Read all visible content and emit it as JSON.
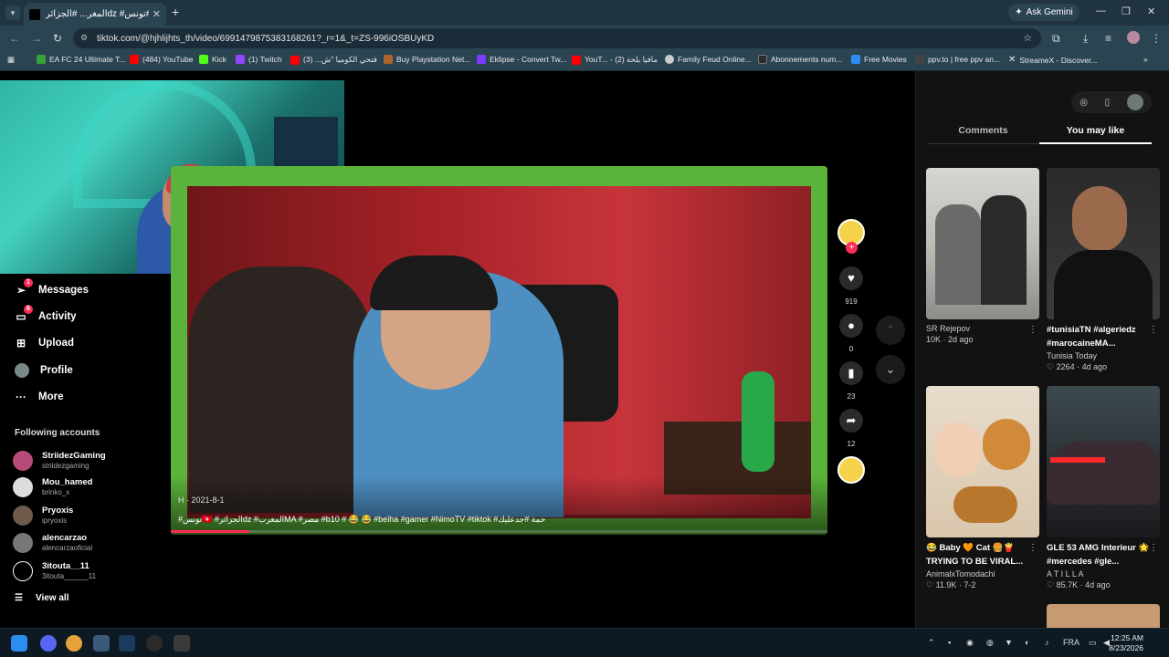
{
  "browser": {
    "tab_title": "المغر... #الجزائرdz #تونس#",
    "ask_gemini": "Ask Gemini",
    "url": "tiktok.com/@hjhlijhts_th/video/6991479875383168261?_r=1&_t=ZS-996iOSBUyKD",
    "bookmarks": [
      {
        "label": "EA FC 24 Ultimate T...",
        "color": "#35a33a"
      },
      {
        "label": "(484) YouTube",
        "color": "#ff0000"
      },
      {
        "label": "Kick",
        "color": "#53fc18"
      },
      {
        "label": "(1) Twitch",
        "color": "#9146ff"
      },
      {
        "label": "فتحي الكوميا \"ش... (3)",
        "color": "#ff0000"
      },
      {
        "label": "Buy Playstation Net...",
        "color": "#b0622b"
      },
      {
        "label": "Eklipse - Convert Tw...",
        "color": "#7a3cff"
      },
      {
        "label": "YouT... - مافيا بلحة (2)",
        "color": "#ff0000"
      },
      {
        "label": "Family Feud Online...",
        "color": "#cccccc"
      },
      {
        "label": "Abonnements num...",
        "color": "#2c2c2c"
      },
      {
        "label": "Free Movies",
        "color": "#2d8cf0"
      },
      {
        "label": "ppv.to | free ppv an...",
        "color": "#444444"
      },
      {
        "label": "StreameX - Discover...",
        "color": "#ffffff"
      }
    ]
  },
  "video": {
    "meta": "H · 2021-8-1",
    "caption": "#تونس🇹🇳 #الجزائرdz #المغربMA #مصر #b10 # 😂 😂 #belha #gamer #NimoTV #tiktok #حمة #جدعليك",
    "progress": 0.12
  },
  "actions": {
    "likes": "919",
    "comments": "0",
    "saves": "23",
    "shares": "12"
  },
  "nav": {
    "items": [
      {
        "label": "Messages",
        "icon": "paper-plane-icon",
        "badge": "1"
      },
      {
        "label": "Activity",
        "icon": "inbox-icon",
        "badge": "6"
      },
      {
        "label": "Upload",
        "icon": "plus-square-icon",
        "badge": ""
      },
      {
        "label": "Profile",
        "icon": "avatar-icon",
        "badge": ""
      },
      {
        "label": "More",
        "icon": "more-dots-icon",
        "badge": ""
      }
    ],
    "following_title": "Following accounts",
    "accounts": [
      {
        "name": "StriidezGaming",
        "handle": "striidezgaming"
      },
      {
        "name": "Mou_hamed",
        "handle": "brinko_x"
      },
      {
        "name": "Pryoxis",
        "handle": "ipryoxis"
      },
      {
        "name": "alencarzao",
        "handle": "alencarzaoficial"
      },
      {
        "name": "3itouta__11",
        "handle": "3itouta______11"
      }
    ],
    "view_all": "View all"
  },
  "panel": {
    "tabs": [
      "Comments",
      "You may like"
    ],
    "active_tab": "You may like",
    "cards": [
      {
        "title": "",
        "author": "SR Rejepov",
        "stats": "10K · 2d ago",
        "likes_icon": false
      },
      {
        "title": "#tunisiaTN #algeriedz #marocaineMA...",
        "author": "Tunisia Today",
        "stats": "2264 · 4d ago",
        "likes_icon": true
      },
      {
        "title": "😂 Baby 🧡 Cat 🍔🍟 TRYING TO BE VIRAL...",
        "author": "AnimalxTomodachi",
        "stats": "11.9K · 7-2",
        "likes_icon": true
      },
      {
        "title": "GLE 53 AMG Interieur 🌟 #mercedes #gle...",
        "author": "A T I L L A",
        "stats": "85.7K · 4d ago",
        "likes_icon": true
      }
    ]
  },
  "taskbar": {
    "lang": "FRA",
    "time": "12:25 AM",
    "date": "8/23/2026"
  }
}
